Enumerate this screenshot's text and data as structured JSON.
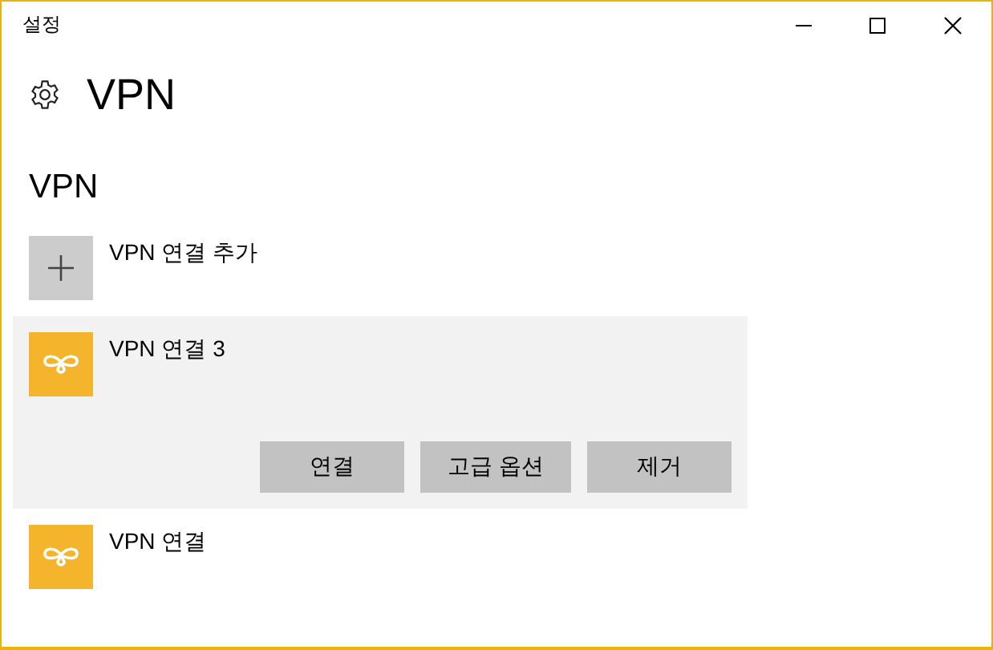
{
  "window": {
    "title": "설정"
  },
  "page": {
    "title": "VPN"
  },
  "section": {
    "heading": "VPN"
  },
  "items": [
    {
      "kind": "add",
      "label": "VPN 연결 추가",
      "selected": false
    },
    {
      "kind": "vpn",
      "label": "VPN 연결 3",
      "selected": true,
      "actions": [
        "연결",
        "고급 옵션",
        "제거"
      ]
    },
    {
      "kind": "vpn",
      "label": "VPN 연결",
      "selected": false
    }
  ]
}
